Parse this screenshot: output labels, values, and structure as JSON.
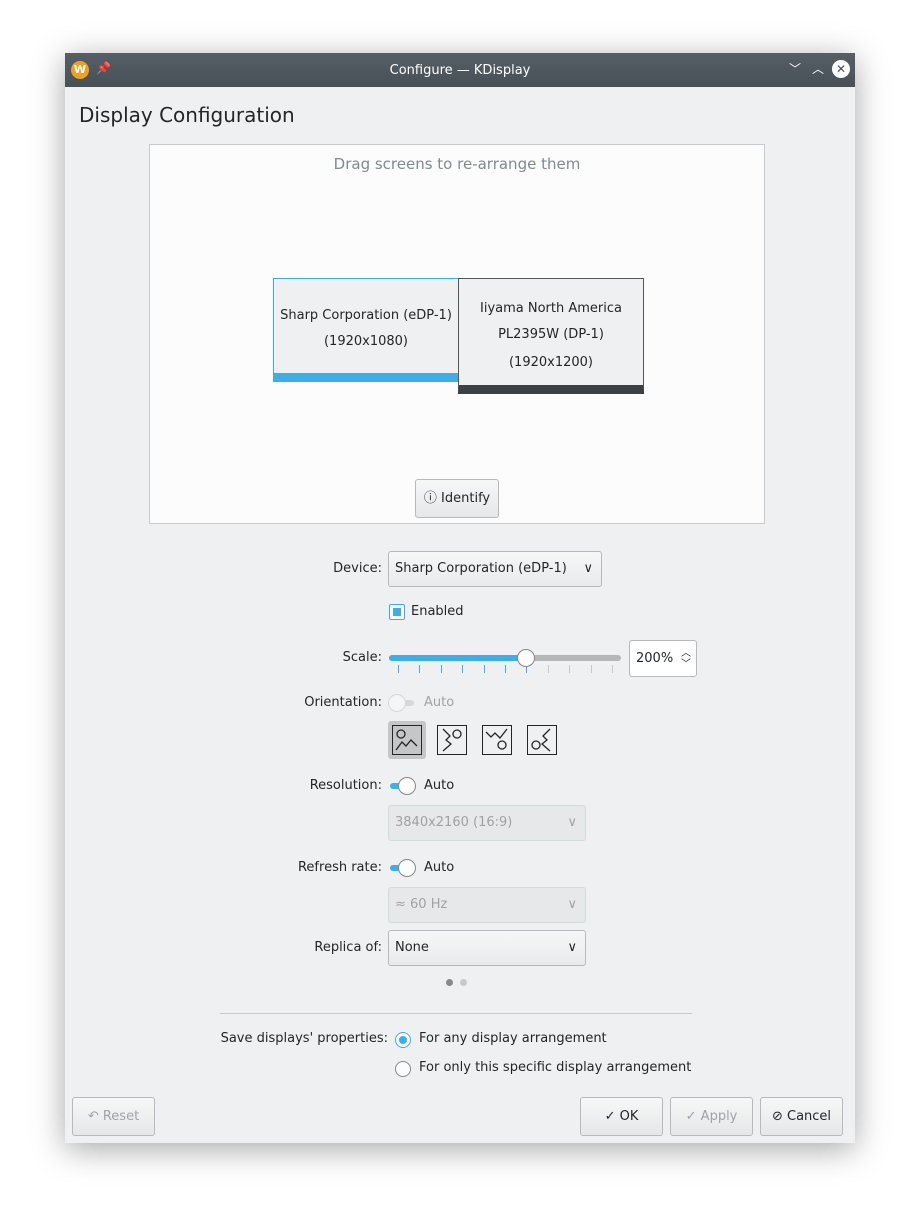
{
  "window": {
    "title": "Configure — KDisplay"
  },
  "page_title": "Display Configuration",
  "arrangement": {
    "hint": "Drag screens to re-arrange them",
    "screens": [
      {
        "line1": "Sharp Corporation (eDP-1)",
        "line2": "(1920x1080)",
        "selected": true
      },
      {
        "line1": "Iiyama North America",
        "line2": "PL2395W (DP-1)",
        "line3": "(1920x1200)",
        "selected": false
      }
    ],
    "identify_label": "Identify"
  },
  "form": {
    "device_label": "Device:",
    "device_value": "Sharp Corporation (eDP-1)",
    "enabled_label": "Enabled",
    "enabled": true,
    "scale_label": "Scale:",
    "scale_value": "200%",
    "scale_slider_fraction": 0.6,
    "orientation_label": "Orientation:",
    "orientation_auto": "Auto",
    "orientations": [
      "landscape",
      "rotate-right",
      "upside-down",
      "rotate-left"
    ],
    "resolution_label": "Resolution:",
    "resolution_auto": "Auto",
    "resolution_value": "3840x2160 (16:9)",
    "refresh_label": "Refresh rate:",
    "refresh_auto": "Auto",
    "refresh_value": "≈ 60 Hz",
    "replica_label": "Replica of:",
    "replica_value": "None",
    "page": 1,
    "pages": 2
  },
  "save": {
    "label": "Save displays' properties:",
    "option1": "For any display arrangement",
    "option2": "For only this specific display arrangement",
    "selected": 1
  },
  "buttons": {
    "reset": "Reset",
    "ok": "OK",
    "apply": "Apply",
    "cancel": "Cancel"
  },
  "colors": {
    "accent": "#3daee9",
    "titlebar": "#4d555c"
  }
}
